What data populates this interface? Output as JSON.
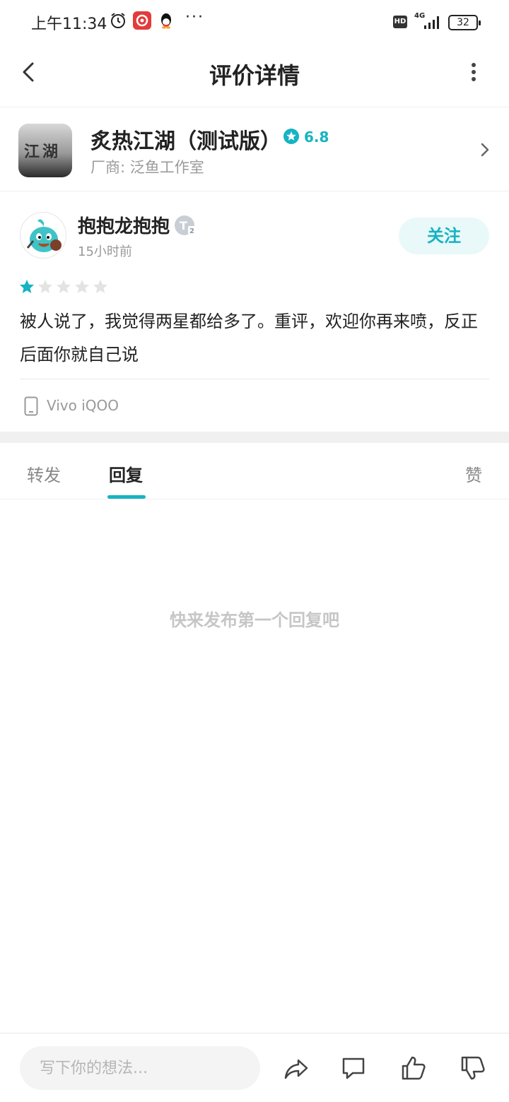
{
  "status_bar": {
    "time": "上午11:34",
    "network": "4G",
    "hd_label": "HD",
    "battery": "32",
    "overflow": "···"
  },
  "header": {
    "title": "评价详情"
  },
  "app": {
    "name": "炙热江湖（测试版）",
    "rating": "6.8",
    "vendor": "厂商: 泛鱼工作室",
    "icon_text": "江湖"
  },
  "review": {
    "username": "抱抱龙抱抱",
    "time_ago": "15小时前",
    "follow_label": "关注",
    "stars": 1,
    "stars_max": 5,
    "text": "被人说了，我觉得两星都给多了。重评，欢迎你再来喷，反正后面你就自己说",
    "device": "Vivo iQOO"
  },
  "tabs": [
    {
      "label": "转发",
      "active": false
    },
    {
      "label": "回复",
      "active": true
    },
    {
      "label": "赞",
      "active": false
    }
  ],
  "empty_state": "快来发布第一个回复吧",
  "bottom_bar": {
    "input_placeholder": "写下你的想法..."
  },
  "colors": {
    "accent": "#16b3c2",
    "accent_bg": "#e9f8f9",
    "star_empty": "#e3e3e3"
  }
}
